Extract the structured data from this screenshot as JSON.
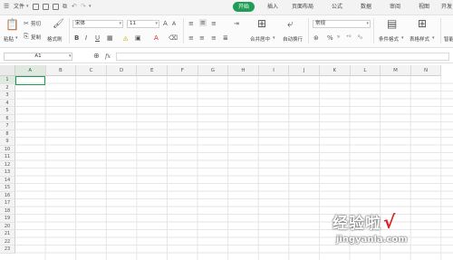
{
  "menubar": {
    "file_menu": "文件",
    "tabs": [
      {
        "label": "开始",
        "active": true
      },
      {
        "label": "插入"
      },
      {
        "label": "页面布局"
      },
      {
        "label": "公式"
      },
      {
        "label": "数据"
      },
      {
        "label": "审阅"
      },
      {
        "label": "视图"
      },
      {
        "label": "开发"
      }
    ]
  },
  "ribbon": {
    "paste": "粘贴",
    "cut": "剪切",
    "copy": "复制",
    "format_painter": "格式刷",
    "font_name": "宋体",
    "font_size": "11",
    "merge_center": "合并居中",
    "wrap_text": "自动换行",
    "number_format": "常规",
    "conditional_format": "条件格式",
    "table_style": "表格样式",
    "sum_partial": "智能"
  },
  "formula_bar": {
    "name_box": "A1",
    "fx": "fx",
    "formula": ""
  },
  "grid": {
    "columns": [
      "A",
      "B",
      "C",
      "D",
      "E",
      "F",
      "G",
      "H",
      "I",
      "J",
      "K",
      "L",
      "M",
      "N"
    ],
    "rows": [
      "1",
      "2",
      "3",
      "4",
      "5",
      "6",
      "7",
      "8",
      "9",
      "10",
      "11",
      "12",
      "13",
      "14",
      "15",
      "16",
      "17",
      "18",
      "19",
      "20",
      "21",
      "22",
      "23"
    ],
    "active_cell": "A1"
  },
  "watermark": {
    "main": "经验啦",
    "check": "√",
    "sub": "jingyanla.com"
  },
  "colors": {
    "accent": "#1f9d55",
    "header_bg": "#f3f3f3",
    "grid_line": "#e6e6e6"
  }
}
